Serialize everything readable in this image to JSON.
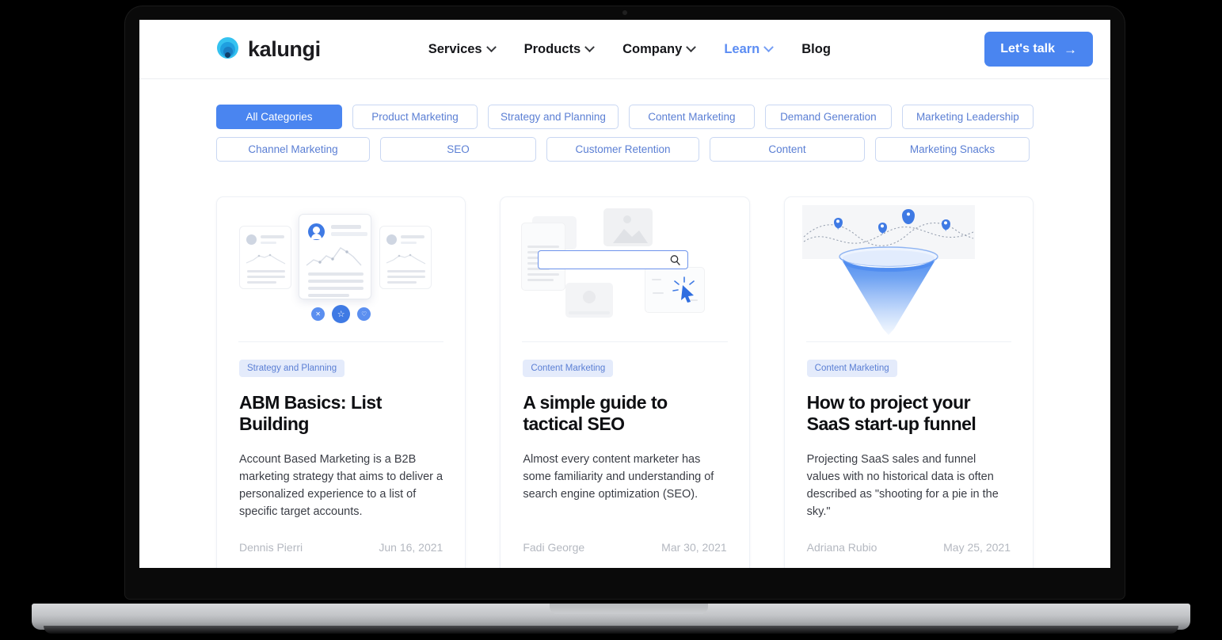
{
  "header": {
    "brand_name": "kalungi",
    "logo_icon": "kalungi-circles-logo",
    "nav_items": [
      {
        "label": "Services",
        "has_dropdown": true,
        "active": false
      },
      {
        "label": "Products",
        "has_dropdown": true,
        "active": false
      },
      {
        "label": "Company",
        "has_dropdown": true,
        "active": false
      },
      {
        "label": "Learn",
        "has_dropdown": true,
        "active": true
      },
      {
        "label": "Blog",
        "has_dropdown": false,
        "active": false
      }
    ],
    "cta_label": "Let's talk",
    "cta_arrow": "→",
    "cta_color": "#4a85f0",
    "active_nav_color": "#5c8df3"
  },
  "filters": {
    "active_pill_color": "#4a85f0",
    "pill_text_color": "#5b7fd4",
    "pill_border_color": "#c9d7f2",
    "row1": [
      {
        "label": "All Categories",
        "active": true
      },
      {
        "label": "Product Marketing",
        "active": false
      },
      {
        "label": "Strategy and Planning",
        "active": false
      },
      {
        "label": "Content Marketing",
        "active": false
      },
      {
        "label": "Demand Generation",
        "active": false
      },
      {
        "label": "Marketing Leadership",
        "active": false
      }
    ],
    "row2": [
      {
        "label": "Channel Marketing",
        "active": false
      },
      {
        "label": "SEO",
        "active": false
      },
      {
        "label": "Customer Retention",
        "active": false
      },
      {
        "label": "Content",
        "active": false
      },
      {
        "label": "Marketing Snacks",
        "active": false
      }
    ]
  },
  "articles": [
    {
      "illustration": "profile-list-cards-illustration",
      "tag": "Strategy and Planning",
      "title": "ABM Basics: List Building",
      "excerpt": "Account Based Marketing is a B2B marketing strategy that aims to deliver a personalized experience to a list of specific target accounts.",
      "author": "Dennis Pierri",
      "date": "Jun 16, 2021"
    },
    {
      "illustration": "search-bar-seo-illustration",
      "tag": "Content Marketing",
      "title": "A simple guide to tactical SEO",
      "excerpt": "Almost every content marketer has some familiarity and understanding of search engine optimization (SEO).",
      "author": "Fadi George",
      "date": "Mar 30, 2021"
    },
    {
      "illustration": "sales-funnel-illustration",
      "tag": "Content Marketing",
      "title": "How to project your SaaS start-up funnel",
      "excerpt": "Projecting SaaS sales and funnel values with no historical data is often described as \"shooting for a pie in the sky.\"",
      "author": "Adriana Rubio",
      "date": "May 25, 2021"
    }
  ],
  "illustration_icons": {
    "card_actions": [
      "✕",
      "☆",
      "♡"
    ],
    "search_icon": "magnifier-icon"
  }
}
